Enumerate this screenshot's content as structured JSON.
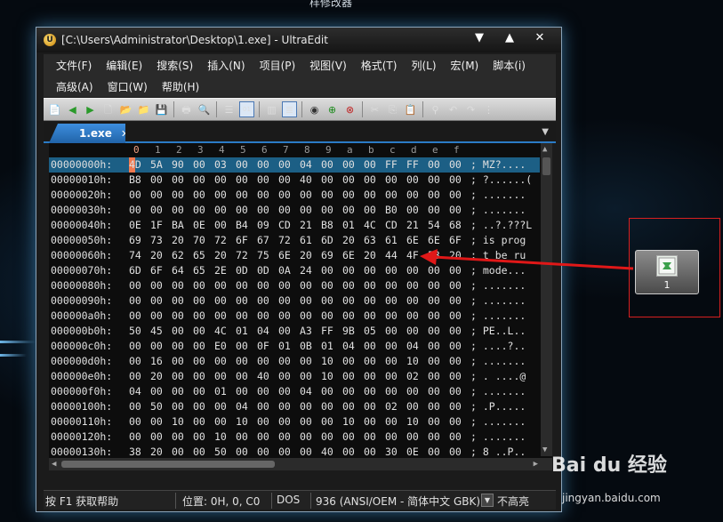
{
  "top_caption": "样修改器",
  "window": {
    "title": "[C:\\Users\\Administrator\\Desktop\\1.exe] - UltraEdit",
    "controls": {
      "menu": "▼",
      "maximize": "▲",
      "close": "✕"
    }
  },
  "menus": {
    "row1": [
      "文件(F)",
      "编辑(E)",
      "搜索(S)",
      "插入(N)",
      "项目(P)",
      "视图(V)",
      "格式(T)",
      "列(L)",
      "宏(M)",
      "脚本(i)"
    ],
    "row2": [
      "高级(A)",
      "窗口(W)",
      "帮助(H)"
    ]
  },
  "toolbar_icons": [
    "new-file",
    "back",
    "forward",
    "new",
    "open",
    "open-folder",
    "save",
    "print",
    "print-preview",
    "text-list",
    "hex-mode",
    "column-mode",
    "word-wrap",
    "ftp",
    "add-green",
    "remove-red",
    "cut",
    "copy",
    "paste",
    "find",
    "undo",
    "redo",
    "more"
  ],
  "tab": {
    "label": "1.exe",
    "close": "✕"
  },
  "hex": {
    "columns": [
      "0",
      "1",
      "2",
      "3",
      "4",
      "5",
      "6",
      "7",
      "8",
      "9",
      "a",
      "b",
      "c",
      "d",
      "e",
      "f"
    ],
    "rows": [
      {
        "addr": "00000000h:",
        "bytes": [
          "4D",
          "5A",
          "90",
          "00",
          "03",
          "00",
          "00",
          "00",
          "04",
          "00",
          "00",
          "00",
          "FF",
          "FF",
          "00",
          "00"
        ],
        "ascii": "; MZ?...."
      },
      {
        "addr": "00000010h:",
        "bytes": [
          "B8",
          "00",
          "00",
          "00",
          "00",
          "00",
          "00",
          "00",
          "40",
          "00",
          "00",
          "00",
          "00",
          "00",
          "00",
          "00"
        ],
        "ascii": "; ?......("
      },
      {
        "addr": "00000020h:",
        "bytes": [
          "00",
          "00",
          "00",
          "00",
          "00",
          "00",
          "00",
          "00",
          "00",
          "00",
          "00",
          "00",
          "00",
          "00",
          "00",
          "00"
        ],
        "ascii": "; ......."
      },
      {
        "addr": "00000030h:",
        "bytes": [
          "00",
          "00",
          "00",
          "00",
          "00",
          "00",
          "00",
          "00",
          "00",
          "00",
          "00",
          "00",
          "B0",
          "00",
          "00",
          "00"
        ],
        "ascii": "; ......."
      },
      {
        "addr": "00000040h:",
        "bytes": [
          "0E",
          "1F",
          "BA",
          "0E",
          "00",
          "B4",
          "09",
          "CD",
          "21",
          "B8",
          "01",
          "4C",
          "CD",
          "21",
          "54",
          "68"
        ],
        "ascii": "; ..?.???L"
      },
      {
        "addr": "00000050h:",
        "bytes": [
          "69",
          "73",
          "20",
          "70",
          "72",
          "6F",
          "67",
          "72",
          "61",
          "6D",
          "20",
          "63",
          "61",
          "6E",
          "6E",
          "6F"
        ],
        "ascii": "; is prog"
      },
      {
        "addr": "00000060h:",
        "bytes": [
          "74",
          "20",
          "62",
          "65",
          "20",
          "72",
          "75",
          "6E",
          "20",
          "69",
          "6E",
          "20",
          "44",
          "4F",
          "53",
          "20"
        ],
        "ascii": "; t be ru"
      },
      {
        "addr": "00000070h:",
        "bytes": [
          "6D",
          "6F",
          "64",
          "65",
          "2E",
          "0D",
          "0D",
          "0A",
          "24",
          "00",
          "00",
          "00",
          "00",
          "00",
          "00",
          "00"
        ],
        "ascii": "; mode..."
      },
      {
        "addr": "00000080h:",
        "bytes": [
          "00",
          "00",
          "00",
          "00",
          "00",
          "00",
          "00",
          "00",
          "00",
          "00",
          "00",
          "00",
          "00",
          "00",
          "00",
          "00"
        ],
        "ascii": "; ......."
      },
      {
        "addr": "00000090h:",
        "bytes": [
          "00",
          "00",
          "00",
          "00",
          "00",
          "00",
          "00",
          "00",
          "00",
          "00",
          "00",
          "00",
          "00",
          "00",
          "00",
          "00"
        ],
        "ascii": "; ......."
      },
      {
        "addr": "000000a0h:",
        "bytes": [
          "00",
          "00",
          "00",
          "00",
          "00",
          "00",
          "00",
          "00",
          "00",
          "00",
          "00",
          "00",
          "00",
          "00",
          "00",
          "00"
        ],
        "ascii": "; ......."
      },
      {
        "addr": "000000b0h:",
        "bytes": [
          "50",
          "45",
          "00",
          "00",
          "4C",
          "01",
          "04",
          "00",
          "A3",
          "FF",
          "9B",
          "05",
          "00",
          "00",
          "00",
          "00"
        ],
        "ascii": "; PE..L.."
      },
      {
        "addr": "000000c0h:",
        "bytes": [
          "00",
          "00",
          "00",
          "00",
          "E0",
          "00",
          "0F",
          "01",
          "0B",
          "01",
          "04",
          "00",
          "00",
          "04",
          "00",
          "00"
        ],
        "ascii": "; ....?.."
      },
      {
        "addr": "000000d0h:",
        "bytes": [
          "00",
          "16",
          "00",
          "00",
          "00",
          "00",
          "00",
          "00",
          "00",
          "10",
          "00",
          "00",
          "00",
          "10",
          "00",
          "00"
        ],
        "ascii": "; ......."
      },
      {
        "addr": "000000e0h:",
        "bytes": [
          "00",
          "20",
          "00",
          "00",
          "00",
          "00",
          "40",
          "00",
          "00",
          "10",
          "00",
          "00",
          "00",
          "02",
          "00",
          "00"
        ],
        "ascii": "; . ....@"
      },
      {
        "addr": "000000f0h:",
        "bytes": [
          "04",
          "00",
          "00",
          "00",
          "01",
          "00",
          "00",
          "00",
          "04",
          "00",
          "00",
          "00",
          "00",
          "00",
          "00",
          "00"
        ],
        "ascii": "; ......."
      },
      {
        "addr": "00000100h:",
        "bytes": [
          "00",
          "50",
          "00",
          "00",
          "00",
          "04",
          "00",
          "00",
          "00",
          "00",
          "00",
          "00",
          "02",
          "00",
          "00",
          "00"
        ],
        "ascii": "; .P....."
      },
      {
        "addr": "00000110h:",
        "bytes": [
          "00",
          "00",
          "10",
          "00",
          "00",
          "10",
          "00",
          "00",
          "00",
          "00",
          "10",
          "00",
          "00",
          "10",
          "00",
          "00"
        ],
        "ascii": "; ......."
      },
      {
        "addr": "00000120h:",
        "bytes": [
          "00",
          "00",
          "00",
          "00",
          "10",
          "00",
          "00",
          "00",
          "00",
          "00",
          "00",
          "00",
          "00",
          "00",
          "00",
          "00"
        ],
        "ascii": "; ......."
      },
      {
        "addr": "00000130h:",
        "bytes": [
          "38",
          "20",
          "00",
          "00",
          "50",
          "00",
          "00",
          "00",
          "00",
          "40",
          "00",
          "00",
          "30",
          "0E",
          "00",
          "00"
        ],
        "ascii": "; 8 ..P.."
      }
    ]
  },
  "status": {
    "help": "按 F1 获取帮助",
    "position": "位置: 0H, 0, C0",
    "line_ending": "DOS",
    "encoding": "936  (ANSI/OEM - 简体中文 GBK)",
    "highlight": "不高亮"
  },
  "desktop_icon": {
    "label": "1"
  },
  "watermark": {
    "main": "Bai du 经验",
    "sub": "jingyan.baidu.com"
  },
  "colors": {
    "accent": "#2b7bc6",
    "selection": "#1c5f85",
    "annotation": "#d82020"
  }
}
